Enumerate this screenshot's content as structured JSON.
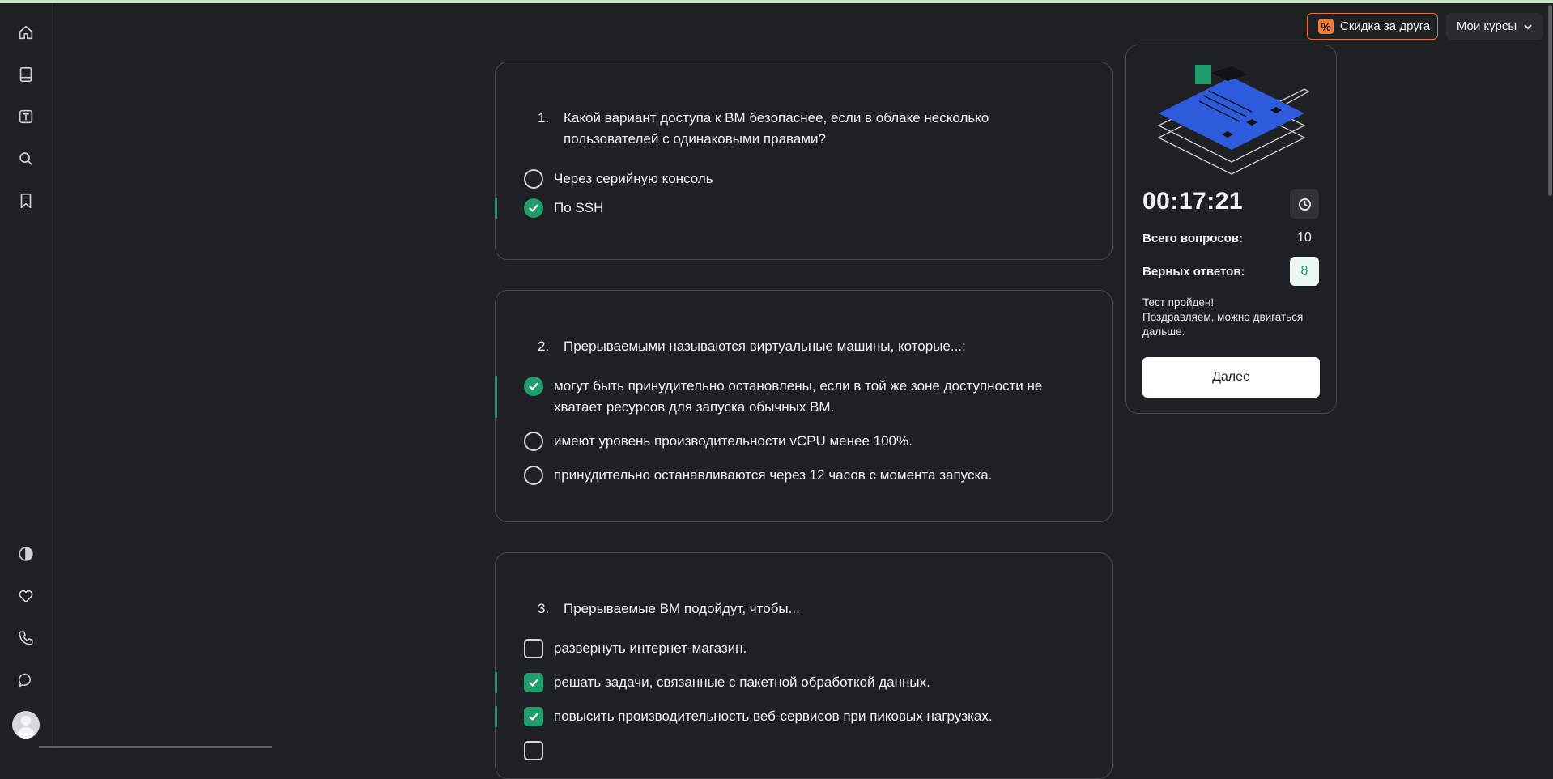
{
  "top_buttons": {
    "promo_label": "Скидка за друга",
    "promo_icon": "%",
    "courses_label": "Мои курсы"
  },
  "sidebar": {
    "items": [
      "home-icon",
      "book-icon",
      "text-tool-icon",
      "search-icon",
      "bookmark-icon"
    ],
    "bottom_items": [
      "theme-contrast-icon",
      "heart-icon",
      "phone-icon",
      "chat-icon"
    ]
  },
  "questions": [
    {
      "number": "1.",
      "text": "Какой вариант доступа к ВМ безопаснее, если в облаке несколько пользователей с одинаковыми правами?",
      "type": "radio",
      "options": [
        {
          "label": "Через серийную консоль",
          "selected": false
        },
        {
          "label": "По SSH",
          "selected": true
        }
      ]
    },
    {
      "number": "2.",
      "text": "Прерываемыми называются виртуальные машины, которые...:",
      "type": "radio",
      "options": [
        {
          "label": "могут быть принудительно остановлены, если в той же зоне доступности не хватает ресурсов для запуска обычных ВМ.",
          "selected": true
        },
        {
          "label": "имеют уровень производительности vCPU менее 100%.",
          "selected": false
        },
        {
          "label": "принудительно останавливаются через 12 часов с момента запуска.",
          "selected": false
        }
      ]
    },
    {
      "number": "3.",
      "text": "Прерываемые ВМ подойдут, чтобы...",
      "type": "checkbox",
      "options": [
        {
          "label": "развернуть интернет-магазин.",
          "selected": false
        },
        {
          "label": "решать задачи, связанные с пакетной обработкой данных.",
          "selected": true
        },
        {
          "label": "повысить производительность веб-сервисов при пиковых нагрузках.",
          "selected": true
        }
      ]
    }
  ],
  "panel": {
    "timer": "00:17:21",
    "total_label": "Всего вопросов:",
    "total_value": "10",
    "correct_label": "Верных ответов:",
    "correct_value": "8",
    "result_line1": "Тест пройден!",
    "result_line2": "Поздравляем, можно двигаться дальше.",
    "next_label": "Далее"
  },
  "colors": {
    "accent_green": "#1f9d6c",
    "promo_orange": "#e8703a",
    "illustration_blue": "#2d5bdc"
  }
}
